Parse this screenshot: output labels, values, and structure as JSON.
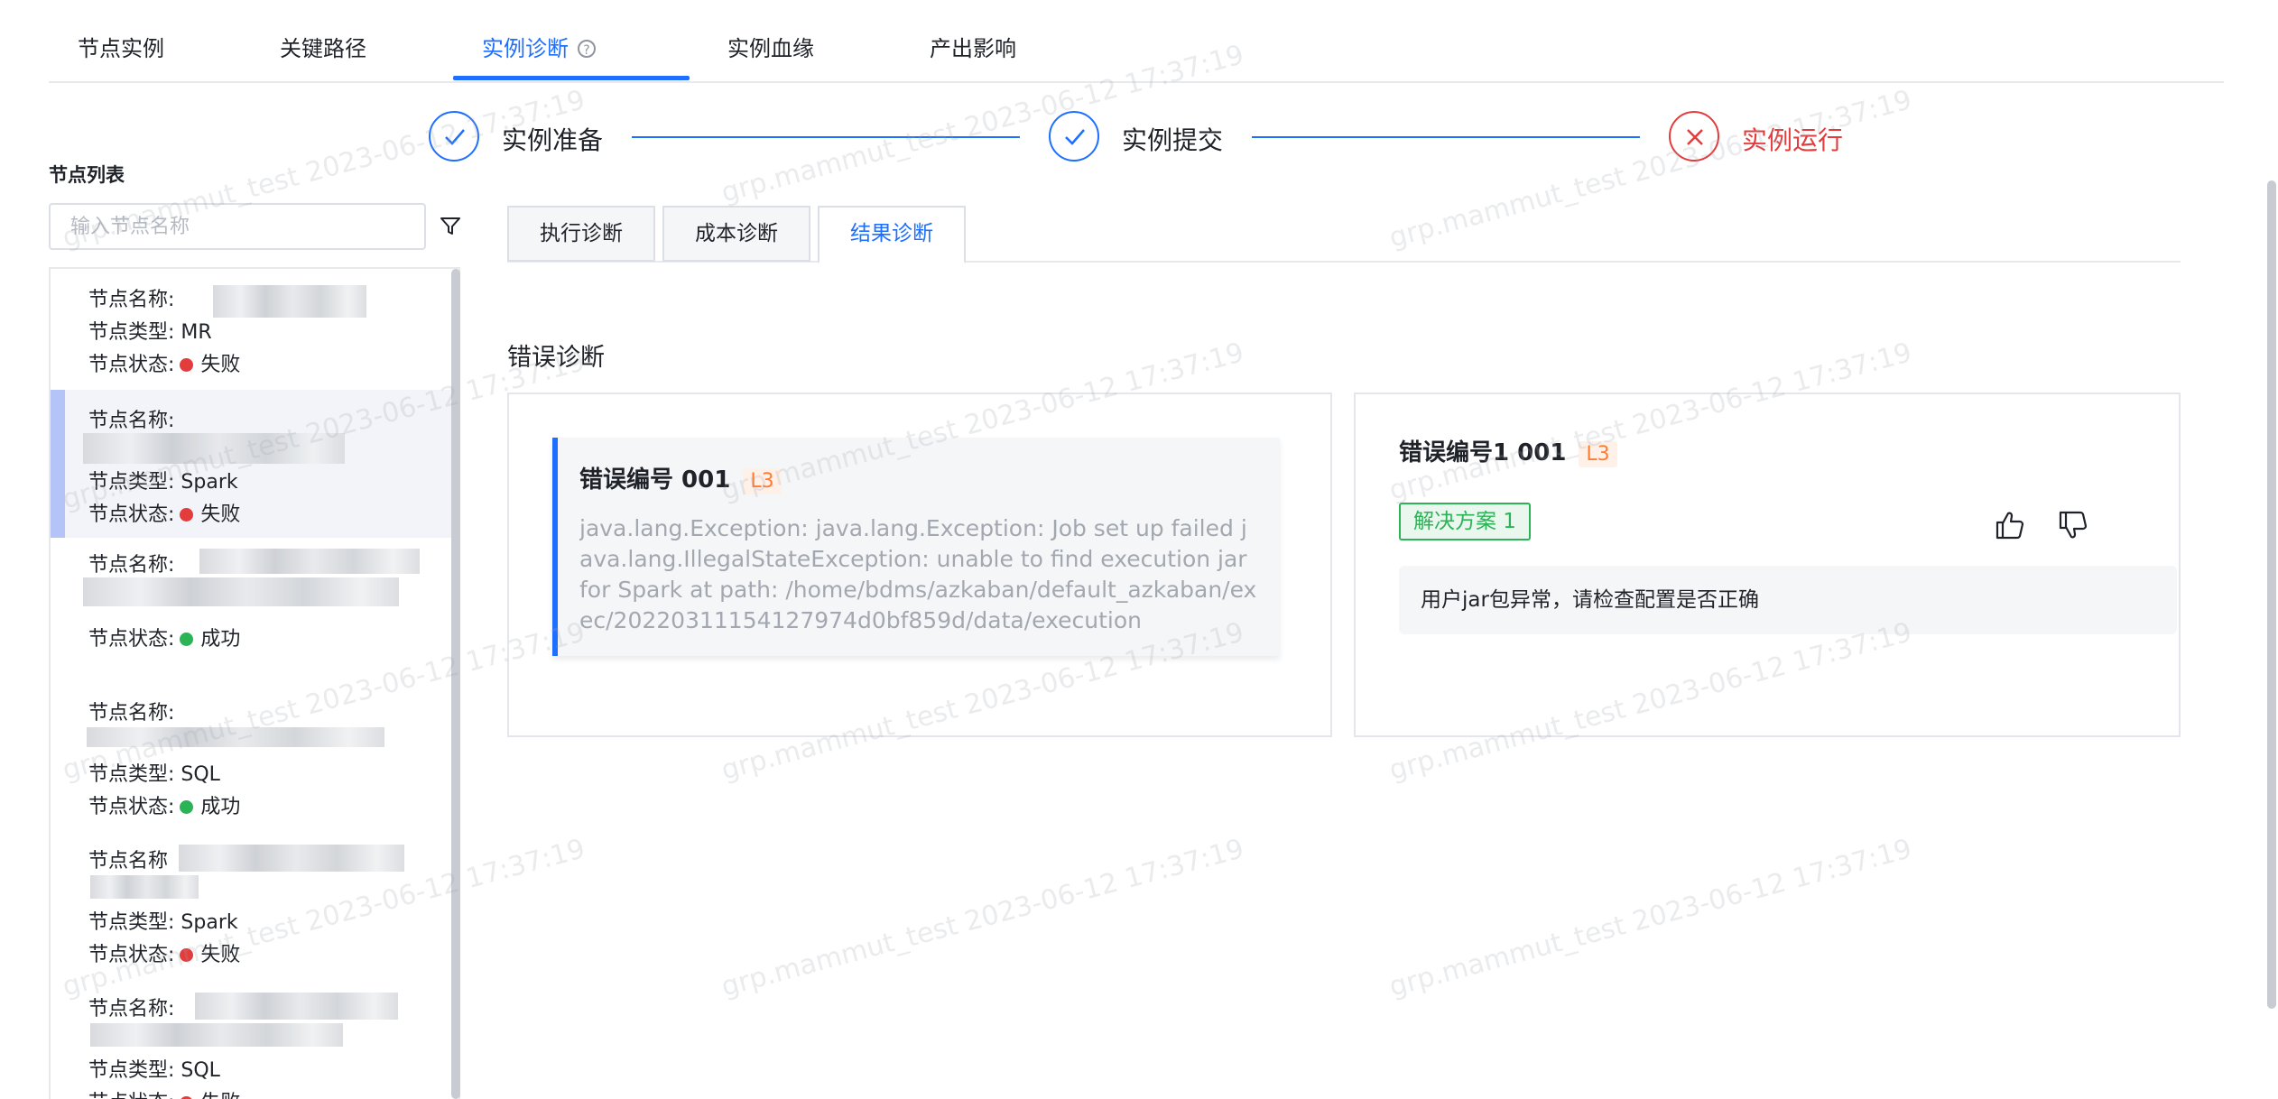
{
  "top_tabs": [
    {
      "label": "节点实例"
    },
    {
      "label": "关键路径"
    },
    {
      "label": "实例诊断"
    },
    {
      "label": "实例血缘"
    },
    {
      "label": "产出影响"
    }
  ],
  "steps": [
    {
      "label": "实例准备",
      "status": "done"
    },
    {
      "label": "实例提交",
      "status": "done"
    },
    {
      "label": "实例运行",
      "status": "failed"
    }
  ],
  "sidebar": {
    "title": "节点列表",
    "search_placeholder": "输入节点名称",
    "items": [
      {
        "name_label": "节点名称:",
        "type_line": "节点类型: MR",
        "status_label": "节点状态:",
        "status_text": "失败",
        "status": "failed"
      },
      {
        "name_label": "节点名称:",
        "type_line": "节点类型: Spark",
        "status_label": "节点状态:",
        "status_text": "失败",
        "status": "failed"
      },
      {
        "name_label": "节点名称:",
        "type_line": "",
        "status_label": "节点状态:",
        "status_text": "成功",
        "status": "success"
      },
      {
        "name_label": "节点名称:",
        "type_line": "节点类型: SQL",
        "status_label": "节点状态:",
        "status_text": "成功",
        "status": "success"
      },
      {
        "name_label": "节点名称",
        "type_line": "节点类型: Spark",
        "status_label": "节点状态:",
        "status_text": "失败",
        "status": "failed"
      },
      {
        "name_label": "节点名称:",
        "type_line": "节点类型: SQL",
        "status_label": "节点状态:",
        "status_text": "失败",
        "status": "failed"
      }
    ]
  },
  "sub_tabs": [
    {
      "label": "执行诊断"
    },
    {
      "label": "成本诊断"
    },
    {
      "label": "结果诊断"
    }
  ],
  "section_title": "错误诊断",
  "error_card": {
    "title": "错误编号 001",
    "level": "L3",
    "detail": "java.lang.Exception: java.lang.Exception: Job set up failed java.lang.IllegalStateException: unable to find execution jar for Spark at path: /home/bdms/azkaban/default_azkaban/exec/20220311154127974d0bf859d/data/execution"
  },
  "solution_card": {
    "title": "错误编号1 001",
    "level": "L3",
    "solution_tag": "解决方案 1",
    "solution_text": "用户jar包异常，请检查配置是否正确"
  },
  "watermark": "grp.mammut_test 2023-06-12 17:37:19",
  "colors": {
    "primary": "#1e6fff",
    "error": "#e33c3c",
    "success": "#2cb356",
    "warning": "#ff7d32"
  }
}
